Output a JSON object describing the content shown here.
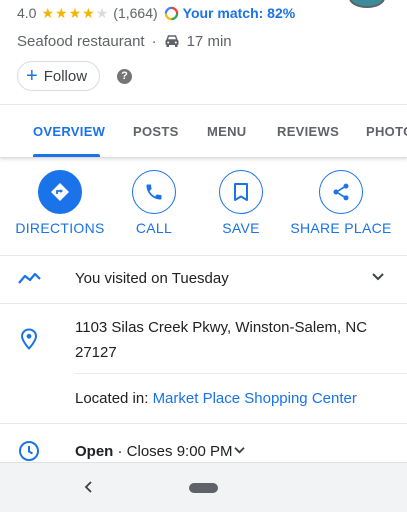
{
  "place": {
    "rating": "4.0",
    "stars_filled": 4,
    "stars_total": 5,
    "review_count": "(1,664)",
    "match_text": "Your match: 82%",
    "category": "Seafood restaurant",
    "separator": "·",
    "drive_time": "17 min"
  },
  "follow": {
    "label": "Follow",
    "icon": "plus-icon"
  },
  "help_icon": "?",
  "tabs": [
    {
      "label": "OVERVIEW",
      "active": true
    },
    {
      "label": "POSTS",
      "active": false
    },
    {
      "label": "MENU",
      "active": false
    },
    {
      "label": "REVIEWS",
      "active": false
    },
    {
      "label": "PHOTOS",
      "active": false
    }
  ],
  "actions": [
    {
      "label": "DIRECTIONS",
      "icon": "directions-icon"
    },
    {
      "label": "CALL",
      "icon": "phone-icon"
    },
    {
      "label": "SAVE",
      "icon": "bookmark-icon"
    },
    {
      "label": "SHARE PLACE",
      "icon": "share-icon"
    }
  ],
  "visited": {
    "text": "You visited on Tuesday"
  },
  "address": {
    "text": "1103 Silas Creek Pkwy, Winston-Salem, NC 27127"
  },
  "located_in": {
    "label": "Located in:",
    "place": "Market Place Shopping Center"
  },
  "hours": {
    "status": "Open",
    "closes": "· Closes 9:00 PM"
  },
  "colors": {
    "accent": "#1a73e8",
    "star": "#f4b400",
    "text_secondary": "#5f6368"
  }
}
